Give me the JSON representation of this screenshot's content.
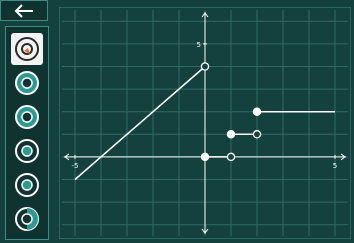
{
  "toolbar": {
    "back_icon": "arrow-left-icon",
    "tools": [
      {
        "icon": "open-closed-circle-icon",
        "selected": true
      },
      {
        "icon": "point-circle-icon",
        "selected": false
      },
      {
        "icon": "point-circle-icon",
        "selected": false
      },
      {
        "icon": "point-circle-icon",
        "selected": false
      },
      {
        "icon": "point-circle-icon",
        "selected": false
      },
      {
        "icon": "point-circle-icon",
        "selected": false
      }
    ]
  },
  "graph": {
    "x_min_label": "-5",
    "x_max_label": "5",
    "y_max_label": "5",
    "xlim": [
      -5.5,
      5.5
    ],
    "ylim": [
      -3.5,
      6.5
    ],
    "segments": [
      {
        "from": [
          -5,
          -1
        ],
        "to": [
          0,
          4
        ],
        "start": "none",
        "end": "open"
      },
      {
        "from": [
          0,
          0
        ],
        "to": [
          1,
          0
        ],
        "start": "closed",
        "end": "open"
      },
      {
        "from": [
          1,
          1
        ],
        "to": [
          2,
          1
        ],
        "start": "closed",
        "end": "open"
      },
      {
        "from": [
          2,
          2
        ],
        "to": [
          5,
          2
        ],
        "start": "closed",
        "end": "none"
      }
    ]
  },
  "colors": {
    "background": "#14403e",
    "panel": "#0f3331",
    "grid": "#2f6b66",
    "axis": "#ffffff",
    "accent": "#2a9a92"
  }
}
